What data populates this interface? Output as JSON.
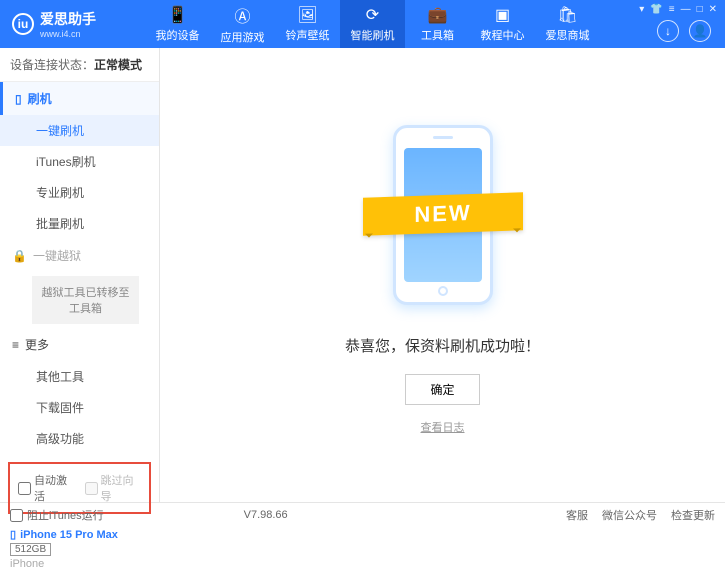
{
  "app": {
    "name": "爱思助手",
    "url": "www.i4.cn",
    "version": "V7.98.66"
  },
  "nav": {
    "items": [
      {
        "label": "我的设备",
        "icon": "📱"
      },
      {
        "label": "应用游戏",
        "icon": "Ⓐ"
      },
      {
        "label": "铃声壁纸",
        "icon": "🖼"
      },
      {
        "label": "智能刷机",
        "icon": "⟳"
      },
      {
        "label": "工具箱",
        "icon": "💼"
      },
      {
        "label": "教程中心",
        "icon": "▣"
      },
      {
        "label": "爱思商城",
        "icon": "🛍"
      }
    ]
  },
  "connection": {
    "label": "设备连接状态：",
    "status": "正常模式"
  },
  "sidebar": {
    "flash_section": "刷机",
    "items": {
      "onekey": "一键刷机",
      "itunes": "iTunes刷机",
      "pro": "专业刷机",
      "batch": "批量刷机"
    },
    "jailbreak_section": "一键越狱",
    "jailbreak_note": "越狱工具已转移至工具箱",
    "more_section": "更多",
    "more": {
      "other": "其他工具",
      "download": "下载固件",
      "advanced": "高级功能"
    }
  },
  "checkboxes": {
    "auto_activate": "自动激活",
    "skip_guide": "跳过向导"
  },
  "device": {
    "name": "iPhone 15 Pro Max",
    "storage": "512GB",
    "type": "iPhone"
  },
  "main": {
    "ribbon": "NEW",
    "success": "恭喜您，保资料刷机成功啦！",
    "ok": "确定",
    "log": "查看日志"
  },
  "footer": {
    "block_itunes": "阻止iTunes运行",
    "links": {
      "service": "客服",
      "wechat": "微信公众号",
      "update": "检查更新"
    }
  }
}
